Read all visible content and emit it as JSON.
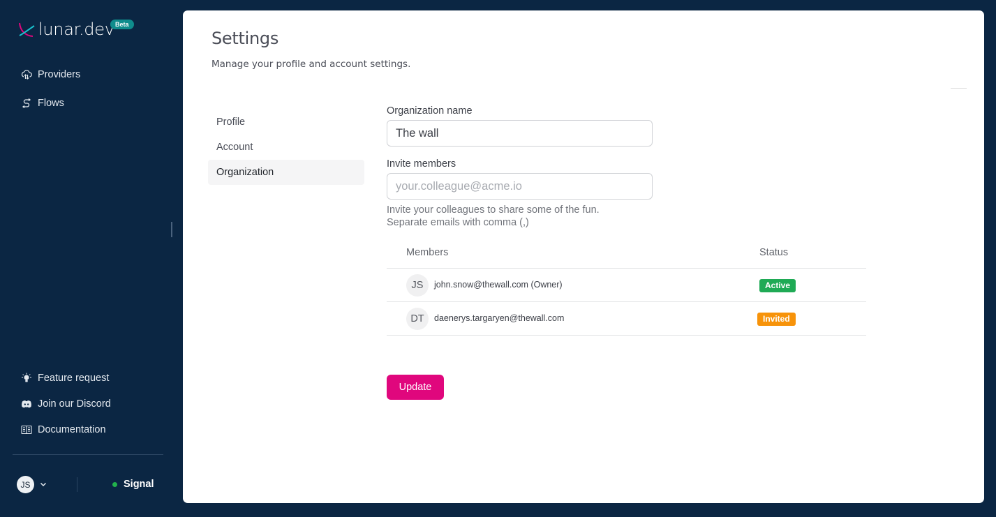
{
  "app": {
    "brand": "lunar.dev",
    "beta_badge": "Beta"
  },
  "sidebar": {
    "nav": [
      {
        "label": "Providers",
        "icon": "cloud-transfer-icon"
      },
      {
        "label": "Flows",
        "icon": "flow-icon"
      }
    ],
    "footer_links": [
      {
        "label": "Feature request",
        "icon": "lightbulb-icon"
      },
      {
        "label": "Join our Discord",
        "icon": "discord-icon"
      },
      {
        "label": "Documentation",
        "icon": "book-icon"
      }
    ],
    "user": {
      "initials": "JS"
    },
    "status": {
      "label": "Signal",
      "color": "#22b14c"
    }
  },
  "page": {
    "title": "Settings",
    "subtitle": "Manage your profile and account settings."
  },
  "tabs": [
    {
      "label": "Profile",
      "active": false
    },
    {
      "label": "Account",
      "active": false
    },
    {
      "label": "Organization",
      "active": true
    }
  ],
  "form": {
    "org_name_label": "Organization name",
    "org_name_value": "The wall",
    "invite_label": "Invite members",
    "invite_placeholder": "your.colleague@acme.io",
    "invite_value": "",
    "help_line1": "Invite your colleagues to share some of the fun.",
    "help_line2": "Separate emails with comma (,)"
  },
  "members_table": {
    "columns": [
      "Members",
      "Status"
    ],
    "rows": [
      {
        "initials": "JS",
        "email": "john.snow@thewall.com (Owner)",
        "status": "Active",
        "status_color": "#1faa55"
      },
      {
        "initials": "DT",
        "email": "daenerys.targaryen@thewall.com",
        "status": "Invited",
        "status_color": "#f7930a"
      }
    ]
  },
  "actions": {
    "update_label": "Update",
    "accent_color": "#e0077d"
  }
}
